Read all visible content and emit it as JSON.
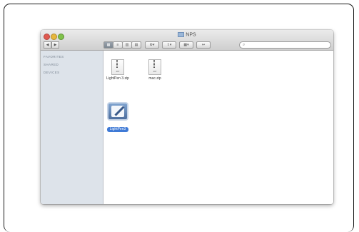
{
  "window": {
    "title": "NPS"
  },
  "toolbar": {
    "back_glyph": "◀",
    "forward_glyph": "▶",
    "view_icon_glyph": "▦",
    "view_list_glyph": "≡",
    "view_column_glyph": "▥",
    "view_coverflow_glyph": "▤",
    "action_glyph": "⚙▾",
    "share_glyph": "⇪▾",
    "arrange_glyph": "▦▾",
    "path_glyph": "↦",
    "search_glyph": "⌕"
  },
  "sidebar": {
    "sections": [
      "FAVORITES",
      "SHARED",
      "DEVICES"
    ]
  },
  "files": [
    {
      "name": "LightPen 3.zip",
      "badge": "ZIP",
      "type": "zip"
    },
    {
      "name": "mac.zip",
      "badge": "ZIP",
      "type": "zip"
    },
    {
      "name": "LightPen3",
      "type": "app",
      "selected": true
    }
  ],
  "colors": {
    "selection": "#3f7ad6",
    "sidebar_bg": "#dde3ea"
  }
}
